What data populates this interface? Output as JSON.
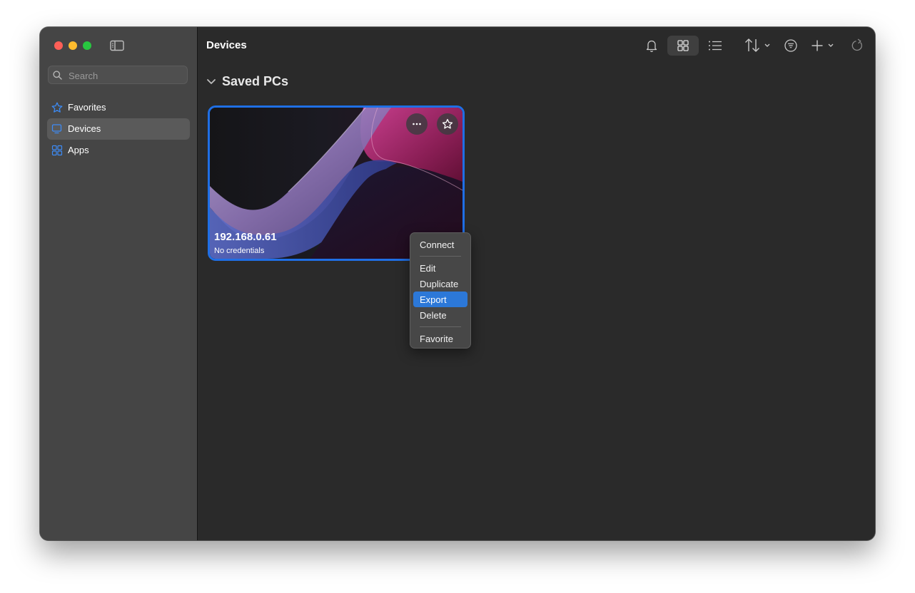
{
  "colors": {
    "accent": "#1f6fe5",
    "sidebar_bg": "#454545",
    "main_bg": "#2a2a2a",
    "menu_highlight": "#2c78d8"
  },
  "sidebar": {
    "search_placeholder": "Search",
    "items": [
      {
        "label": "Favorites",
        "icon": "star-icon"
      },
      {
        "label": "Devices",
        "icon": "monitor-icon",
        "active": true
      },
      {
        "label": "Apps",
        "icon": "apps-grid-icon"
      }
    ]
  },
  "header": {
    "title": "Devices",
    "toolbar_icons": [
      "bell-icon",
      "grid-view-icon",
      "list-view-icon",
      "sort-icon",
      "filter-icon",
      "add-icon",
      "refresh-icon"
    ]
  },
  "section": {
    "title": "Saved PCs"
  },
  "card": {
    "name": "192.168.0.61",
    "subtitle": "No credentials"
  },
  "context_menu": {
    "items": [
      "Connect",
      "Edit",
      "Duplicate",
      "Export",
      "Delete",
      "Favorite"
    ],
    "highlighted": "Export"
  }
}
